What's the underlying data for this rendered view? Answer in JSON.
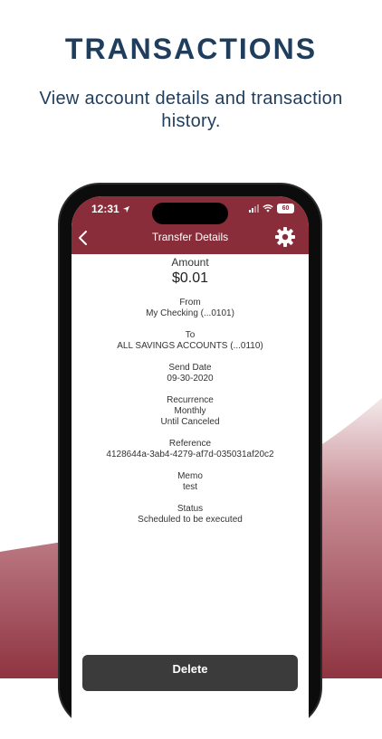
{
  "promo": {
    "headline": "TRANSACTIONS",
    "subhead": "View account details and transaction history."
  },
  "status_bar": {
    "time": "12:31",
    "battery": "60"
  },
  "nav": {
    "title": "Transfer Details"
  },
  "details": {
    "amount_label": "Amount",
    "amount_value": "$0.01",
    "fields": [
      {
        "label": "From",
        "values": [
          "My Checking (...0101)"
        ]
      },
      {
        "label": "To",
        "values": [
          "ALL SAVINGS ACCOUNTS (...0110)"
        ]
      },
      {
        "label": "Send Date",
        "values": [
          "09-30-2020"
        ]
      },
      {
        "label": "Recurrence",
        "values": [
          "Monthly",
          "Until Canceled"
        ]
      },
      {
        "label": "Reference",
        "values": [
          "4128644a-3ab4-4279-af7d-035031af20c2"
        ]
      },
      {
        "label": "Memo",
        "values": [
          "test"
        ]
      },
      {
        "label": "Status",
        "values": [
          "Scheduled to be executed"
        ]
      }
    ]
  },
  "actions": {
    "delete_label": "Delete"
  },
  "colors": {
    "brand_maroon": "#8a2d3a",
    "headline_navy": "#1f3d5c",
    "button_dark": "#3b3b3b"
  },
  "icons": [
    "back-chevron-icon",
    "gear-icon",
    "location-arrow-icon",
    "signal-icon",
    "wifi-icon",
    "battery-icon"
  ]
}
